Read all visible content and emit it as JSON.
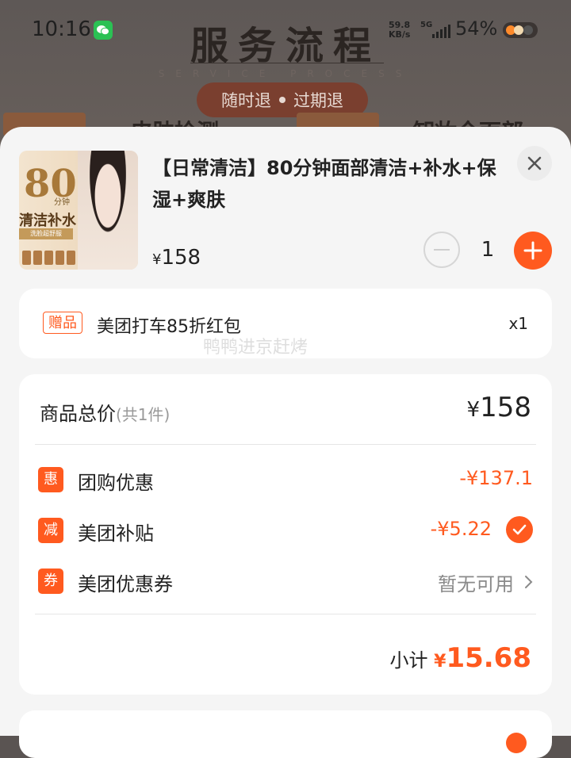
{
  "status_bar": {
    "time": "10:16",
    "net_speed_value": "59.8",
    "net_speed_unit": "KB/s",
    "signal_label": "5G",
    "battery": "54%"
  },
  "background": {
    "title": "服务流程",
    "subtitle": "SERVICE PROCESS",
    "pill_left": "随时退",
    "pill_right": "过期退",
    "text_left": "皮肤检测",
    "text_right": "卸妆全面部"
  },
  "product": {
    "image_text": {
      "number": "80",
      "small": "分钟",
      "label": "清洁补水",
      "band": "洗脸超舒服"
    },
    "title": "【日常清洁】80分钟面部清洁+补水+保湿+爽肤",
    "currency": "¥",
    "price": "158",
    "quantity": "1"
  },
  "gift": {
    "tag": "赠品",
    "text": "美团打车85折红包",
    "qty": "x1"
  },
  "watermark": "鸭鸭进京赶烤",
  "summary": {
    "total_label": "商品总价",
    "total_count": "(共1件)",
    "total_currency": "¥",
    "total_value": "158",
    "rows": [
      {
        "badge": "惠",
        "label": "团购优惠",
        "value": "-¥137.1"
      },
      {
        "badge": "减",
        "label": "美团补贴",
        "value": "-¥5.22"
      },
      {
        "badge": "券",
        "label": "美团优惠券",
        "value": "暂无可用"
      }
    ],
    "subtotal_label": "小计",
    "subtotal_currency": "¥",
    "subtotal_value": "15.68"
  },
  "colors": {
    "accent": "#ff5a1f",
    "background": "#f5f5f5",
    "card": "#ffffff"
  }
}
